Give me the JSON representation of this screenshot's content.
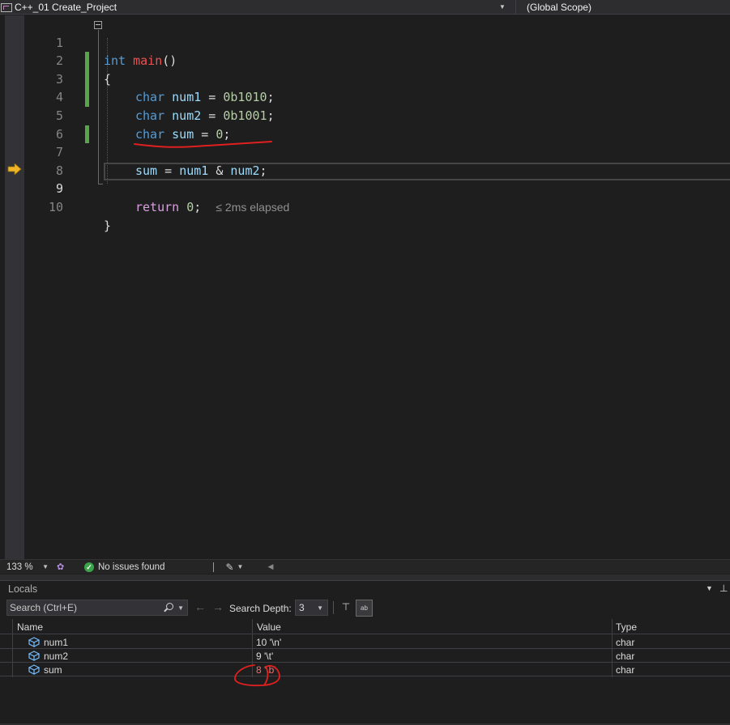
{
  "navbar": {
    "project": "C++_01 Create_Project",
    "scope": "(Global Scope)",
    "project_icon": "project-icon",
    "dropdown_icon": "chevron-down-icon"
  },
  "editor": {
    "line_numbers": [
      "1",
      "2",
      "3",
      "4",
      "5",
      "6",
      "7",
      "8",
      "9",
      "10"
    ],
    "current_line": "9",
    "lines": {
      "l1": {
        "kw": "int",
        "fn": "main",
        "punct": "()"
      },
      "l2": {
        "text": "{"
      },
      "l3": {
        "kw": "char",
        "var": "num1",
        "op": " = ",
        "num": "0b1010",
        "end": ";"
      },
      "l4": {
        "kw": "char",
        "var": "num2",
        "op": " = ",
        "num": "0b1001",
        "end": ";"
      },
      "l5": {
        "kw": "char",
        "var": "sum",
        "op": " = ",
        "num": "0",
        "end": ";"
      },
      "l7": {
        "var1": "sum",
        "op1": " = ",
        "var2": "num1",
        "op2": " & ",
        "var3": "num2",
        "end": ";"
      },
      "l9": {
        "ctl": "return",
        "num": "0",
        "end": ";",
        "elapsed": "≤ 2ms elapsed"
      },
      "l10": {
        "text": "}"
      }
    }
  },
  "statusbar": {
    "zoom": "133 %",
    "issues": "No issues found"
  },
  "locals": {
    "title": "Locals",
    "search_placeholder": "Search (Ctrl+E)",
    "search_depth_label": "Search Depth:",
    "search_depth": "3",
    "hex_label": "ab",
    "columns": {
      "name": "Name",
      "value": "Value",
      "type": "Type"
    },
    "rows": [
      {
        "name": "num1",
        "value": "10 '\\n'",
        "type": "char"
      },
      {
        "name": "num2",
        "value": "9 '\\t'",
        "type": "char"
      },
      {
        "name": "sum",
        "value": "8 '\\b'",
        "type": "char"
      }
    ]
  },
  "colors": {
    "background": "#1e1e1e",
    "keyword": "#569cd6",
    "variable": "#9cdcfe",
    "number": "#b5cea8",
    "control": "#d8a0df",
    "changed_bar": "#57a64a",
    "exec_arrow": "#f0b429",
    "annotation": "#e02020"
  }
}
